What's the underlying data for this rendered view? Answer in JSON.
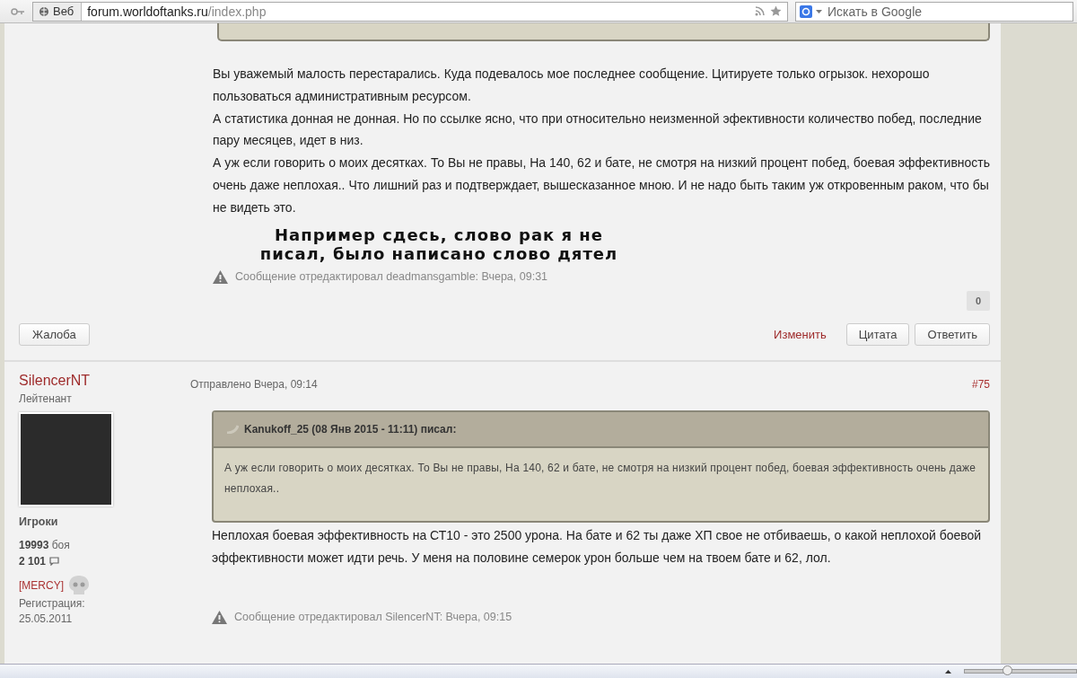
{
  "browser": {
    "scope_label": "Веб",
    "url_host": "forum.worldoftanks.ru",
    "url_path": "/index.php",
    "search_placeholder": "Искать в Google"
  },
  "status_bar": {
    "zoom_slider": {
      "level": 0.38
    }
  },
  "previous_post": {
    "body": [
      "Вы уважемый малость перестарались. Куда подевалось мое последнее сообщение. Цитируете только огрызок. нехорошо пользоваться административным ресурсом.",
      "А статистика донная не донная. Но по ссылке ясно, что при относительно неизменной эфективности количество побед, последние пару месяцев, идет в низ.",
      "А уж если говорить о моих десятках. То Вы не правы, На 140, 62 и бате, не смотря на низкий процент побед, боевая эффективность очень даже неплохая.. Что лишний раз и подтверждает, вышесказанное мною. И не надо быть таким уж откровенным раком, что бы не видеть это."
    ],
    "annotation": "Например сдесь, слово рак я не писал, было написано слово дятел",
    "edit_note": "Сообщение отредактировал deadmansgamble: Вчера, 09:31",
    "like_count": "0",
    "report_button": "Жалоба",
    "edit_link": "Изменить",
    "buttons": [
      "Цитата",
      "Ответить"
    ]
  },
  "post": {
    "author": "SilencerNT",
    "rank": "Лейтенант",
    "posted": "Отправлено Вчера, 09:14",
    "post_number": "#75",
    "group": "Игроки",
    "battles_count": "19993",
    "battles_label": "боя",
    "posts_count": "2 101",
    "clan": "[MERCY]",
    "registration_label": "Регистрация:",
    "registration_date": "25.05.2011",
    "quote": {
      "header": "Kanukoff_25 (08 Янв 2015 - 11:11) писал:",
      "text": "А уж если говорить о моих десятках. То Вы не правы, На 140, 62 и бате, не смотря на низкий процент побед, боевая эффективность очень даже неплохая.."
    },
    "body": "Неплохая боевая эффективность на СТ10 - это 2500 урона. На бате и 62 ты даже ХП свое не отбиваешь, о какой неплохой боевой эффективности может идти речь. У меня на половине семерок урон больше чем на твоем бате и 62, лол.",
    "edit_note": "Сообщение отредактировал SilencerNT: Вчера, 09:15"
  }
}
